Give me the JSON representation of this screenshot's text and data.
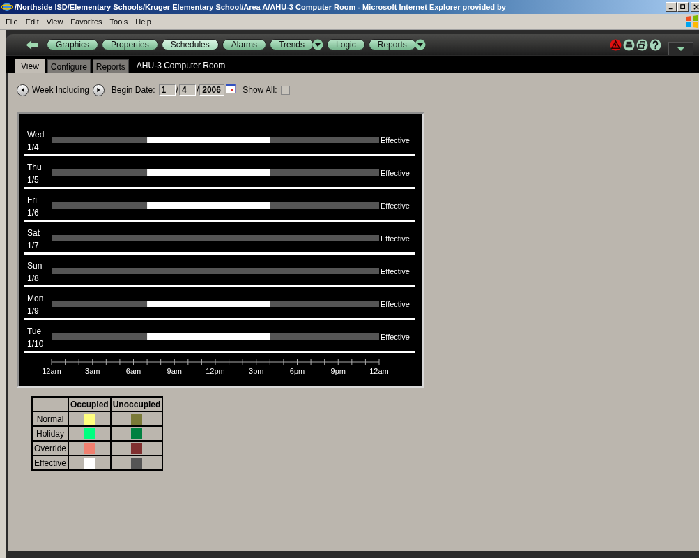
{
  "window": {
    "title": "/Northside ISD/Elementary Schools/Kruger Elementary School/Area A/AHU-3 Computer Room - Microsoft Internet Explorer provided by"
  },
  "menu": [
    "File",
    "Edit",
    "View",
    "Favorites",
    "Tools",
    "Help"
  ],
  "nav_buttons": [
    {
      "label": "Graphics",
      "selected": false,
      "dropdown": false
    },
    {
      "label": "Properties",
      "selected": false,
      "dropdown": false
    },
    {
      "label": "Schedules",
      "selected": true,
      "dropdown": false
    },
    {
      "label": "Alarms",
      "selected": false,
      "dropdown": false
    },
    {
      "label": "Trends",
      "selected": false,
      "dropdown": true
    },
    {
      "label": "Logic",
      "selected": false,
      "dropdown": false
    },
    {
      "label": "Reports",
      "selected": false,
      "dropdown": true
    }
  ],
  "tabs": [
    {
      "label": "View",
      "selected": true
    },
    {
      "label": "Configure",
      "selected": false
    },
    {
      "label": "Reports",
      "selected": false
    }
  ],
  "page_title": "AHU-3 Computer Room",
  "week": {
    "label": "Week Including",
    "begin_date_label": "Begin Date:",
    "month": "1",
    "day": "4",
    "year": "2006",
    "separator": "/",
    "show_all_label": "Show All:",
    "show_all_checked": false
  },
  "schedule": {
    "days": [
      {
        "day": "Wed",
        "date": "1/4",
        "status": "Effective",
        "occupied": true
      },
      {
        "day": "Thu",
        "date": "1/5",
        "status": "Effective",
        "occupied": true
      },
      {
        "day": "Fri",
        "date": "1/6",
        "status": "Effective",
        "occupied": true
      },
      {
        "day": "Sat",
        "date": "1/7",
        "status": "Effective",
        "occupied": false
      },
      {
        "day": "Sun",
        "date": "1/8",
        "status": "Effective",
        "occupied": false
      },
      {
        "day": "Mon",
        "date": "1/9",
        "status": "Effective",
        "occupied": true
      },
      {
        "day": "Tue",
        "date": "1/10",
        "status": "Effective",
        "occupied": true
      }
    ],
    "axis_labels": [
      "12am",
      "3am",
      "6am",
      "9am",
      "12pm",
      "3pm",
      "6pm",
      "9pm",
      "12am"
    ]
  },
  "legend": {
    "columns": [
      "Occupied",
      "Unoccupied"
    ],
    "rows": [
      {
        "label": "Normal",
        "occupied": {
          "color": "#ffff80"
        },
        "unoccupied": {
          "color": "#7a7a38"
        }
      },
      {
        "label": "Holiday",
        "occupied": {
          "color": "#00ff80"
        },
        "unoccupied": {
          "color": "#008040"
        }
      },
      {
        "label": "Override",
        "occupied": {
          "color": "#f08070"
        },
        "unoccupied": {
          "color": "#803030"
        }
      },
      {
        "label": "Effective",
        "occupied": {
          "color": "#ffffff"
        },
        "unoccupied": {
          "color": "#555555"
        }
      }
    ]
  }
}
